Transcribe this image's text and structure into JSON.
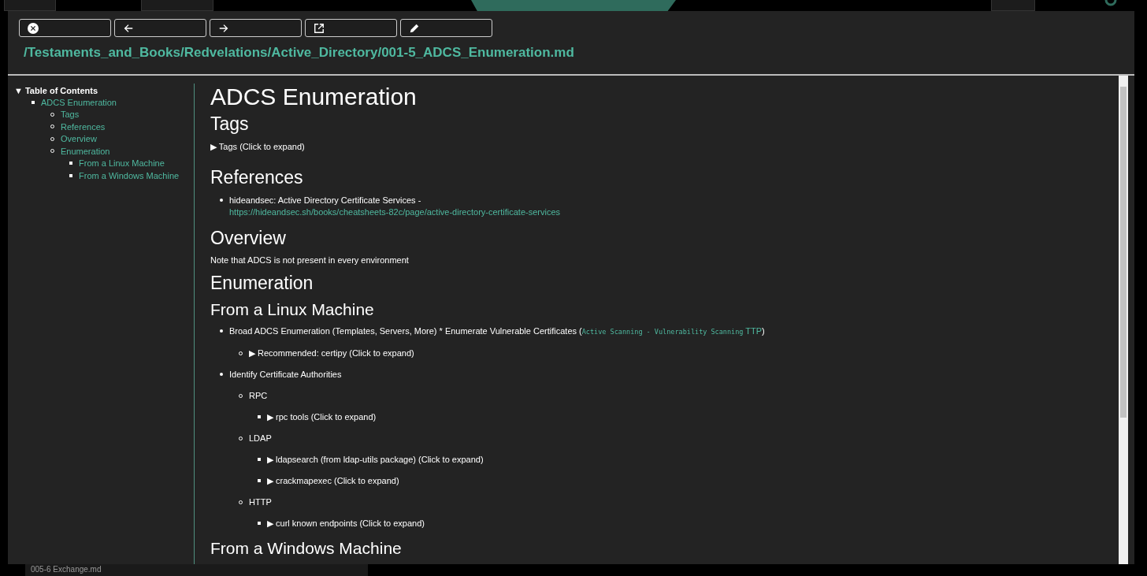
{
  "background": {
    "files": [
      "005-6 Exchange.md"
    ]
  },
  "viewer": {
    "path": "/Testaments_and_Books/Redvelations/Active_Directory/001-5_ADCS_Enumeration.md",
    "toc": {
      "marker": "▼",
      "title": "Table of Contents",
      "items": [
        {
          "label": "ADCS Enumeration",
          "children": [
            {
              "label": "Tags"
            },
            {
              "label": "References"
            },
            {
              "label": "Overview"
            },
            {
              "label": "Enumeration",
              "children": [
                {
                  "label": "From a Linux Machine"
                },
                {
                  "label": "From a Windows Machine"
                }
              ]
            }
          ]
        }
      ]
    },
    "content": [
      {
        "kind": "h1",
        "text": "ADCS Enumeration"
      },
      {
        "kind": "h2",
        "text": "Tags"
      },
      {
        "kind": "details",
        "text": "▶ Tags (Click to expand)"
      },
      {
        "kind": "h2",
        "text": "References"
      },
      {
        "kind": "list",
        "items": [
          {
            "text": "hideandsec: Active Directory Certificate Services -",
            "link": "https://hideandsec.sh/books/cheatsheets-82c/page/active-directory-certificate-services"
          }
        ]
      },
      {
        "kind": "h2",
        "text": "Overview"
      },
      {
        "kind": "para",
        "text": "Note that ADCS is not present in every environment"
      },
      {
        "kind": "h2",
        "text": "Enumeration"
      },
      {
        "kind": "h3",
        "text": "From a Linux Machine"
      },
      {
        "kind": "list",
        "items": [
          {
            "text": "Broad ADCS Enumeration (Templates, Servers, More) * Enumerate Vulnerable Certificates (",
            "code": "Active Scanning - Vulnerability Scanning",
            "inline_link": "TTP",
            "after": ")",
            "children": [
              {
                "details": "▶ Recommended: certipy (Click to expand)"
              }
            ]
          },
          {
            "text": "Identify Certificate Authorities",
            "children": [
              {
                "text": "RPC",
                "children": [
                  {
                    "details": "▶ rpc tools (Click to expand)"
                  }
                ]
              },
              {
                "text": "LDAP",
                "children": [
                  {
                    "details": "▶ ldapsearch (from ldap-utils package) (Click to expand)"
                  },
                  {
                    "details": "▶ crackmapexec (Click to expand)"
                  }
                ]
              },
              {
                "text": "HTTP",
                "children": [
                  {
                    "details": "▶ curl known endpoints (Click to expand)"
                  }
                ]
              }
            ]
          }
        ]
      },
      {
        "kind": "h3",
        "text": "From a Windows Machine"
      }
    ]
  }
}
